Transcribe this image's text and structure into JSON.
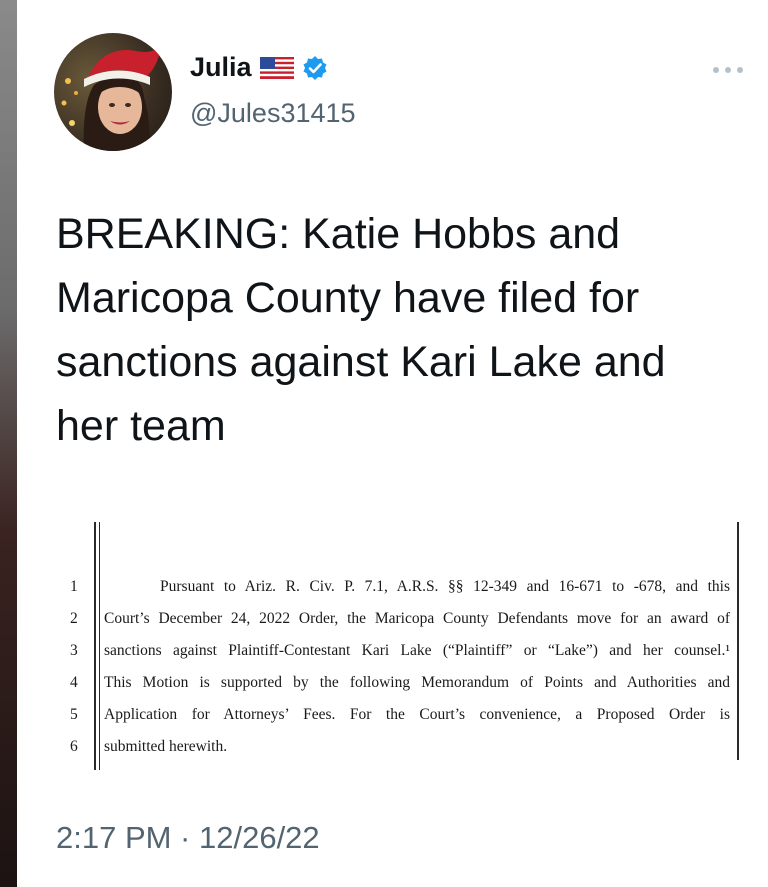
{
  "author": {
    "name": "Julia",
    "handle": "@Jules31415",
    "flag_icon": "us-flag-icon",
    "verified_icon": "verified-badge-icon",
    "verified_color": "#1d9bf0"
  },
  "tweet": {
    "text": "BREAKING: Katie Hobbs and\nMaricopa County have filed for\nsanctions against Kari Lake and\nher team",
    "timestamp": "2:17 PM · 12/26/22"
  },
  "document": {
    "lines": [
      {
        "num": "1",
        "text": "Pursuant to Ariz. R. Civ. P. 7.1, A.R.S. §§ 12-349 and 16-671 to -678, and this"
      },
      {
        "num": "2",
        "text": "Court’s December 24, 2022 Order, the Maricopa County Defendants move for an award of"
      },
      {
        "num": "3",
        "text": "sanctions against Plaintiff-Contestant Kari Lake (“Plaintiff” or “Lake”) and her counsel.¹"
      },
      {
        "num": "4",
        "text": "This Motion is supported by the following Memorandum of Points and Authorities and"
      },
      {
        "num": "5",
        "text": "Application for Attorneys’ Fees.  For the Court’s convenience, a Proposed Order is"
      },
      {
        "num": "6",
        "text": "submitted herewith."
      }
    ]
  },
  "colors": {
    "text_primary": "#0f1419",
    "text_secondary": "#536471"
  }
}
